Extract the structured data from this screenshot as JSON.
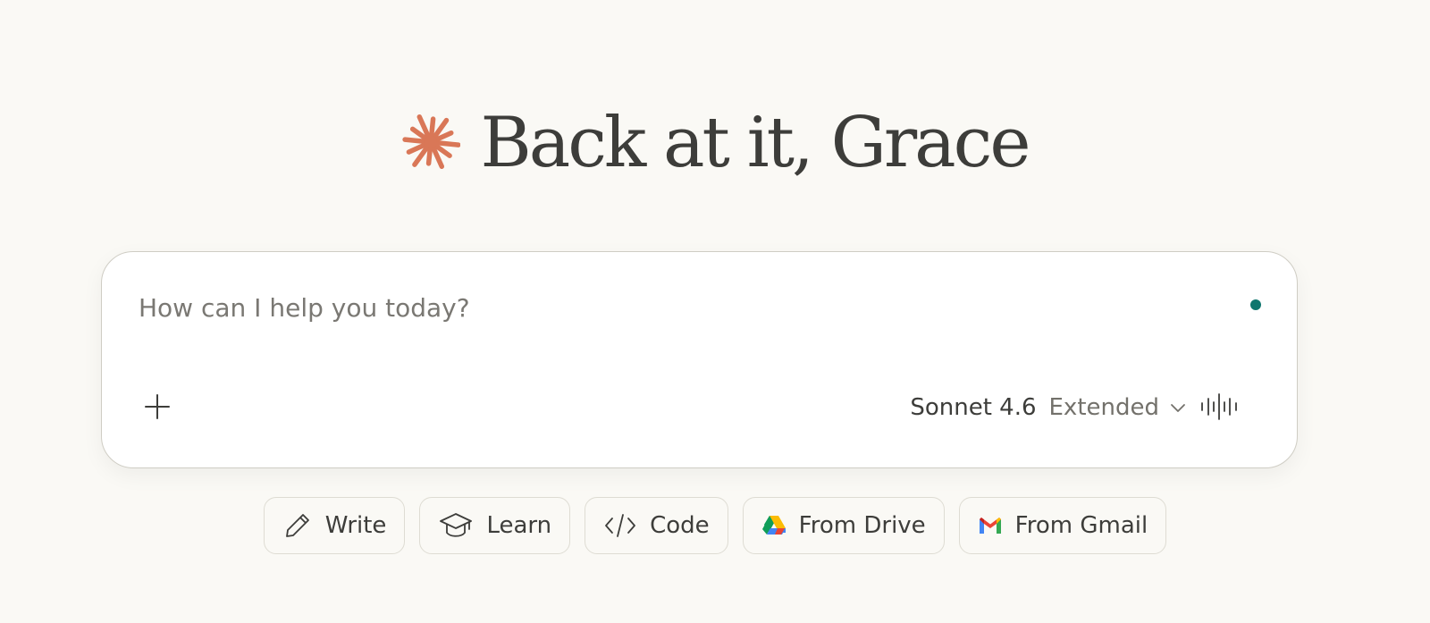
{
  "greeting": {
    "text": "Back at it, Grace",
    "logo_icon": "claude-spark-icon",
    "logo_color": "#d97757"
  },
  "composer": {
    "placeholder": "How can I help you today?",
    "value": "",
    "status_dot_color": "#0f766e",
    "add_icon": "plus-icon",
    "model": {
      "name": "Sonnet 4.6",
      "mode": "Extended",
      "chevron_icon": "chevron-down-icon"
    },
    "voice_icon": "voice-waveform-icon"
  },
  "quick_actions": [
    {
      "label": "Write",
      "icon": "pencil-icon"
    },
    {
      "label": "Learn",
      "icon": "graduation-cap-icon"
    },
    {
      "label": "Code",
      "icon": "code-icon"
    },
    {
      "label": "From Drive",
      "icon": "google-drive-icon"
    },
    {
      "label": "From Gmail",
      "icon": "gmail-icon"
    }
  ]
}
